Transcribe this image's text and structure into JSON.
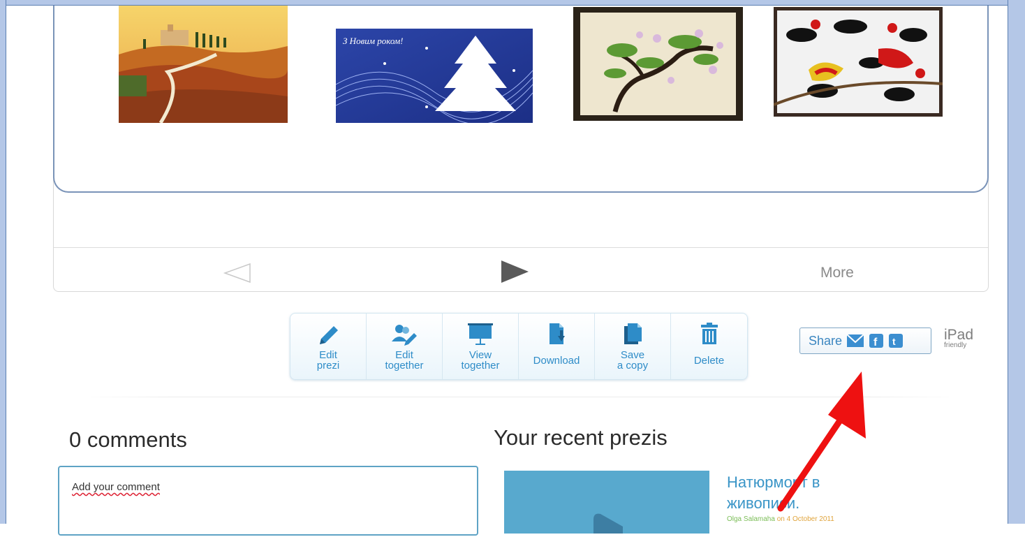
{
  "viewer": {
    "more_label": "More",
    "thumbnails": [
      {
        "name": "tuscany-landscape-painting",
        "caption": ""
      },
      {
        "name": "new-year-card",
        "caption": "З Новим роком!"
      },
      {
        "name": "blossom-tree-embroidery",
        "caption": ""
      },
      {
        "name": "stained-glass-birds",
        "caption": ""
      }
    ]
  },
  "toolbar": {
    "items": [
      {
        "label": "Edit\nprezi",
        "icon": "pencil-icon"
      },
      {
        "label": "Edit\ntogether",
        "icon": "people-pencil-icon"
      },
      {
        "label": "View\ntogether",
        "icon": "projector-screen-icon"
      },
      {
        "label": "Download",
        "icon": "download-icon"
      },
      {
        "label": "Save\na copy",
        "icon": "copy-icon"
      },
      {
        "label": "Delete",
        "icon": "trash-icon"
      }
    ]
  },
  "share": {
    "label": "Share"
  },
  "ipad": {
    "big": "iPad",
    "small": "friendly"
  },
  "comments": {
    "title": "0 comments",
    "input_value": "Add your comment"
  },
  "recent": {
    "title": "Your recent prezis",
    "items": [
      {
        "title": "Натюрморт в живописи.",
        "author": "Olga Salamaha",
        "date_text": " on 4 October 2011"
      }
    ]
  },
  "colors": {
    "accent_blue": "#2e8cc8",
    "frame_blue": "#b4c7e7",
    "arrow_red": "#ee1111"
  }
}
